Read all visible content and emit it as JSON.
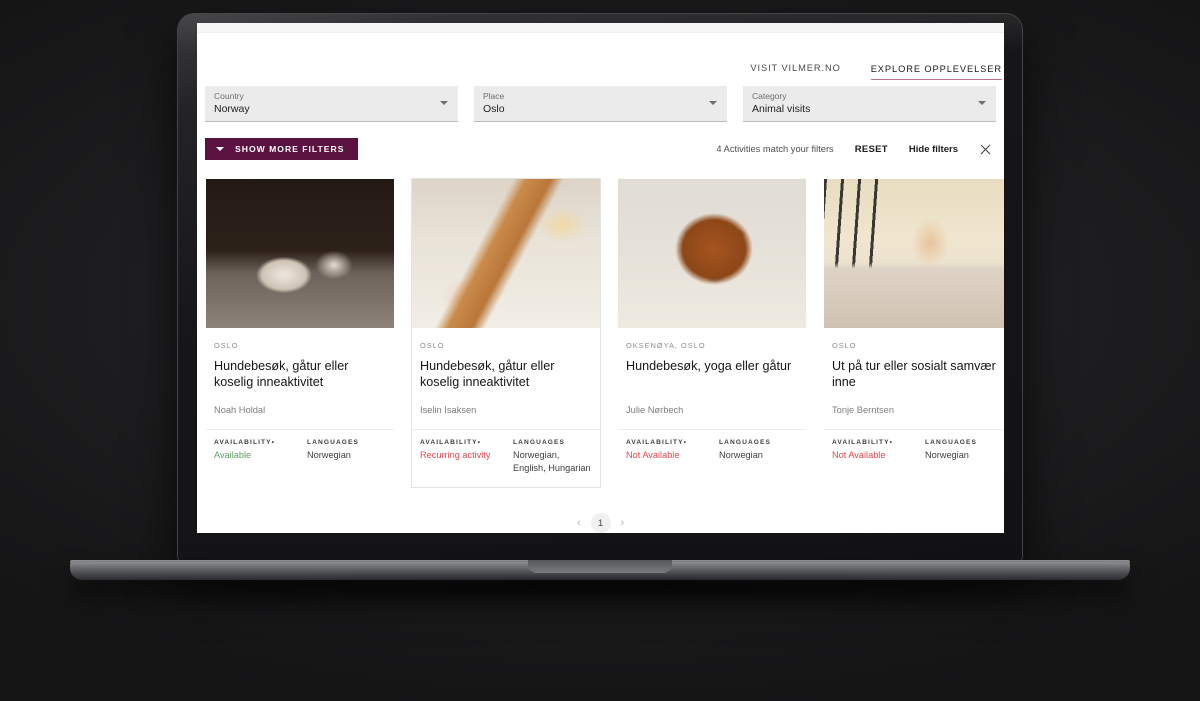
{
  "header": {
    "nav": [
      {
        "label": "VISIT VILMER.NO",
        "active": false
      },
      {
        "label": "EXPLORE OPPLEVELSER",
        "active": true
      }
    ]
  },
  "filters": {
    "selects": [
      {
        "label": "Country",
        "value": "Norway",
        "icon": "chevron-down-icon"
      },
      {
        "label": "Place",
        "value": "Oslo",
        "icon": "chevron-down-icon"
      },
      {
        "label": "Category",
        "value": "Animal visits",
        "icon": "chevron-down-icon"
      }
    ],
    "show_more_label": "SHOW MORE FILTERS",
    "match_count": "4 Activities match your filters",
    "reset_label": "RESET",
    "hide_filters_label": "Hide filters",
    "close_icon": "close-icon"
  },
  "cards": [
    {
      "place": "OSLO",
      "title": "Hundebesøk, gåtur eller koselig inneaktivitet",
      "author": "Noah Holdal",
      "availability_header": "AVAILABILITY",
      "availability_value": "Available",
      "availability_state": "available",
      "languages_header": "LANGUAGES",
      "languages_value": "Norwegian",
      "image": "dog-walking-photo",
      "selected": false
    },
    {
      "place": "OSLO",
      "title": "Hundebesøk, gåtur eller koselig inneaktivitet",
      "author": "Iselin Isaksen",
      "availability_header": "AVAILABILITY",
      "availability_value": "Recurring activity",
      "availability_state": "recurring",
      "languages_header": "LANGUAGES",
      "languages_value": "Norwegian, English, Hungarian",
      "image": "baking-photo",
      "selected": true
    },
    {
      "place": "OKSENØYA, OSLO",
      "title": "Hundebesøk, yoga eller gåtur",
      "author": "Julie Nørbech",
      "availability_header": "AVAILABILITY",
      "availability_value": "Not Available",
      "availability_state": "unavailable",
      "languages_header": "LANGUAGES",
      "languages_value": "Norwegian",
      "image": "puppy-photo",
      "selected": false
    },
    {
      "place": "OSLO",
      "title": "Ut på tur eller sosialt samvær inne",
      "author": "Tonje Berntsen",
      "availability_header": "AVAILABILITY",
      "availability_value": "Not Available",
      "availability_state": "unavailable",
      "languages_header": "LANGUAGES",
      "languages_value": "Norwegian",
      "image": "portrait-photo",
      "selected": false
    }
  ],
  "pagination": {
    "prev_icon": "chevron-left-icon",
    "next_icon": "chevron-right-icon",
    "current_page": "1"
  },
  "colors": {
    "brand_purple": "#5c1240",
    "tab_underline": "#c1708f",
    "available_green": "#5f9d63",
    "unavailable_red": "#e0484d"
  }
}
